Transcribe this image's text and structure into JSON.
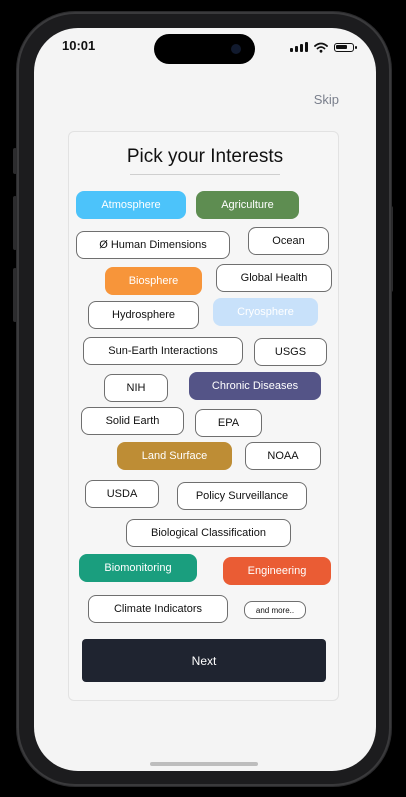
{
  "status": {
    "time": "10:01"
  },
  "header": {
    "skip_label": "Skip"
  },
  "main": {
    "title": "Pick your Interests",
    "next_label": "Next",
    "chips": [
      {
        "label": "Atmosphere",
        "style": "filled",
        "color": "#4cc3fa"
      },
      {
        "label": "Agriculture",
        "style": "filled",
        "color": "#5e8d51"
      },
      {
        "label": "Ø Human Dimensions",
        "style": "outline"
      },
      {
        "label": "Ocean",
        "style": "outline"
      },
      {
        "label": "Biosphere",
        "style": "filled",
        "color": "#f7953a"
      },
      {
        "label": "Global Health",
        "style": "outline"
      },
      {
        "label": "Hydrosphere",
        "style": "outline"
      },
      {
        "label": "Cryosphere",
        "style": "filled",
        "color": "#c8e1fa"
      },
      {
        "label": "Sun-Earth Interactions",
        "style": "outline"
      },
      {
        "label": "USGS",
        "style": "outline"
      },
      {
        "label": "NIH",
        "style": "outline"
      },
      {
        "label": "Chronic Diseases",
        "style": "filled",
        "color": "#545487"
      },
      {
        "label": "Solid Earth",
        "style": "outline"
      },
      {
        "label": "EPA",
        "style": "outline"
      },
      {
        "label": "Land Surface",
        "style": "filled",
        "color": "#be8d35"
      },
      {
        "label": "NOAA",
        "style": "outline"
      },
      {
        "label": "USDA",
        "style": "outline"
      },
      {
        "label": "Policy Surveillance",
        "style": "outline"
      },
      {
        "label": "Biological Classification",
        "style": "outline"
      },
      {
        "label": "Biomonitoring",
        "style": "filled",
        "color": "#1a9e7e"
      },
      {
        "label": "Engineering",
        "style": "filled",
        "color": "#ea5c34"
      },
      {
        "label": "Climate Indicators",
        "style": "outline"
      },
      {
        "label": "and more..",
        "style": "outline"
      }
    ]
  }
}
